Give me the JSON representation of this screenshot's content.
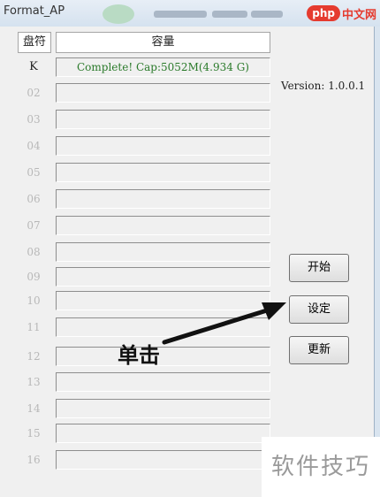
{
  "window": {
    "title": "Format_AP"
  },
  "watermark": {
    "badge": "php",
    "site": "中文网",
    "bottom": "软件技巧"
  },
  "table": {
    "header_drive": "盘符",
    "header_capacity": "容量",
    "rows": [
      {
        "label": "K",
        "status": "Complete! Cap:5052M(4.934 G)"
      },
      {
        "label": "02",
        "status": ""
      },
      {
        "label": "03",
        "status": ""
      },
      {
        "label": "04",
        "status": ""
      },
      {
        "label": "05",
        "status": ""
      },
      {
        "label": "06",
        "status": ""
      },
      {
        "label": "07",
        "status": ""
      },
      {
        "label": "08",
        "status": ""
      },
      {
        "label": "09",
        "status": ""
      },
      {
        "label": "10",
        "status": ""
      },
      {
        "label": "11",
        "status": ""
      },
      {
        "label": "12",
        "status": ""
      },
      {
        "label": "13",
        "status": ""
      },
      {
        "label": "14",
        "status": ""
      },
      {
        "label": "15",
        "status": ""
      },
      {
        "label": "16",
        "status": ""
      }
    ]
  },
  "version": "Version: 1.0.0.1",
  "buttons": {
    "start": "开始",
    "settings": "设定",
    "update": "更新"
  },
  "annotation": "单击"
}
